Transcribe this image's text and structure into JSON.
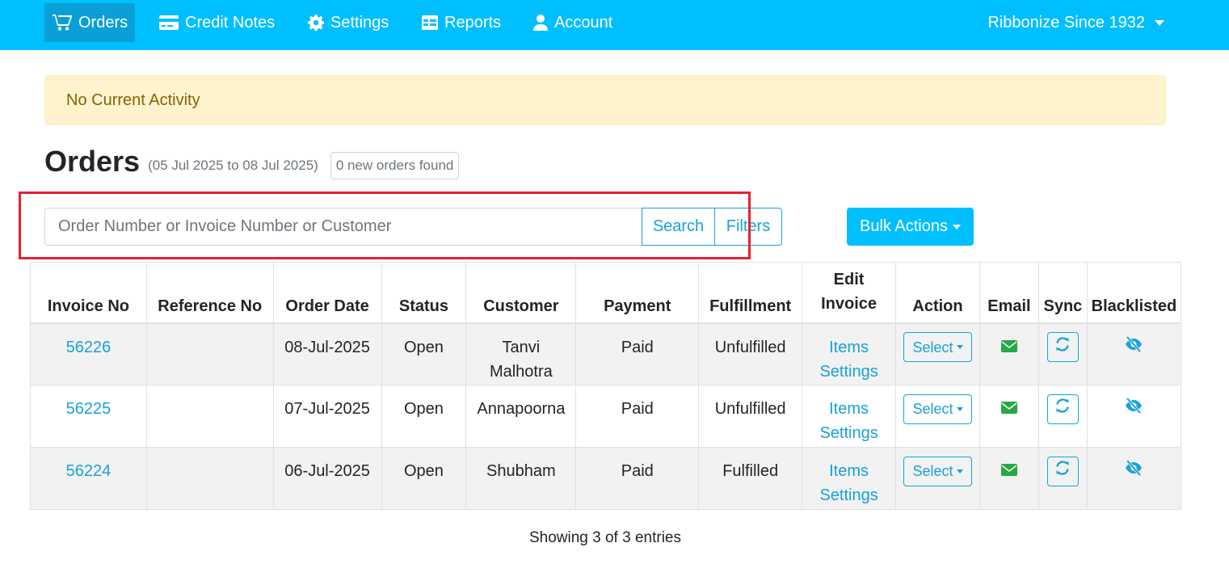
{
  "nav": {
    "items": [
      {
        "label": "Orders",
        "icon": "cart-icon"
      },
      {
        "label": "Credit Notes",
        "icon": "credit-card-icon"
      },
      {
        "label": "Settings",
        "icon": "gear-icon"
      },
      {
        "label": "Reports",
        "icon": "table-icon"
      },
      {
        "label": "Account",
        "icon": "user-icon"
      }
    ],
    "user": "Ribbonize Since 1932"
  },
  "alert": "No Current Activity",
  "page": {
    "title": "Orders",
    "range": "(05 Jul 2025 to 08 Jul 2025)",
    "badge": "0 new orders found"
  },
  "search": {
    "placeholder": "Order Number or Invoice Number or Customer",
    "search_label": "Search",
    "filters_label": "Filters",
    "bulk_label": "Bulk Actions"
  },
  "table": {
    "headers": {
      "invoice": "Invoice No",
      "reference": "Reference No",
      "date": "Order Date",
      "status": "Status",
      "customer": "Customer",
      "payment": "Payment",
      "fulfillment": "Fulfillment",
      "edit_line1": "Edit",
      "edit_line2": "Invoice",
      "action": "Action",
      "email": "Email",
      "sync": "Sync",
      "blacklisted": "Blacklisted"
    },
    "rows": [
      {
        "invoice": "56226",
        "reference": "",
        "date": "08-Jul-2025",
        "status": "Open",
        "customer": "Tanvi Malhotra",
        "payment": "Paid",
        "fulfillment": "Unfulfilled",
        "items": "Items",
        "settings": "Settings",
        "select": "Select"
      },
      {
        "invoice": "56225",
        "reference": "",
        "date": "07-Jul-2025",
        "status": "Open",
        "customer": "Annapoorna",
        "payment": "Paid",
        "fulfillment": "Unfulfilled",
        "items": "Items",
        "settings": "Settings",
        "select": "Select"
      },
      {
        "invoice": "56224",
        "reference": "",
        "date": "06-Jul-2025",
        "status": "Open",
        "customer": "Shubham",
        "payment": "Paid",
        "fulfillment": "Fulfilled",
        "items": "Items",
        "settings": "Settings",
        "select": "Select"
      }
    ]
  },
  "footer": "Showing 3 of 3 entries",
  "colors": {
    "navbar": "#00bfff",
    "accent": "#17a2d8",
    "email_icon": "#28a745",
    "alert_bg": "#fff3cd",
    "highlight": "#e8212e"
  }
}
